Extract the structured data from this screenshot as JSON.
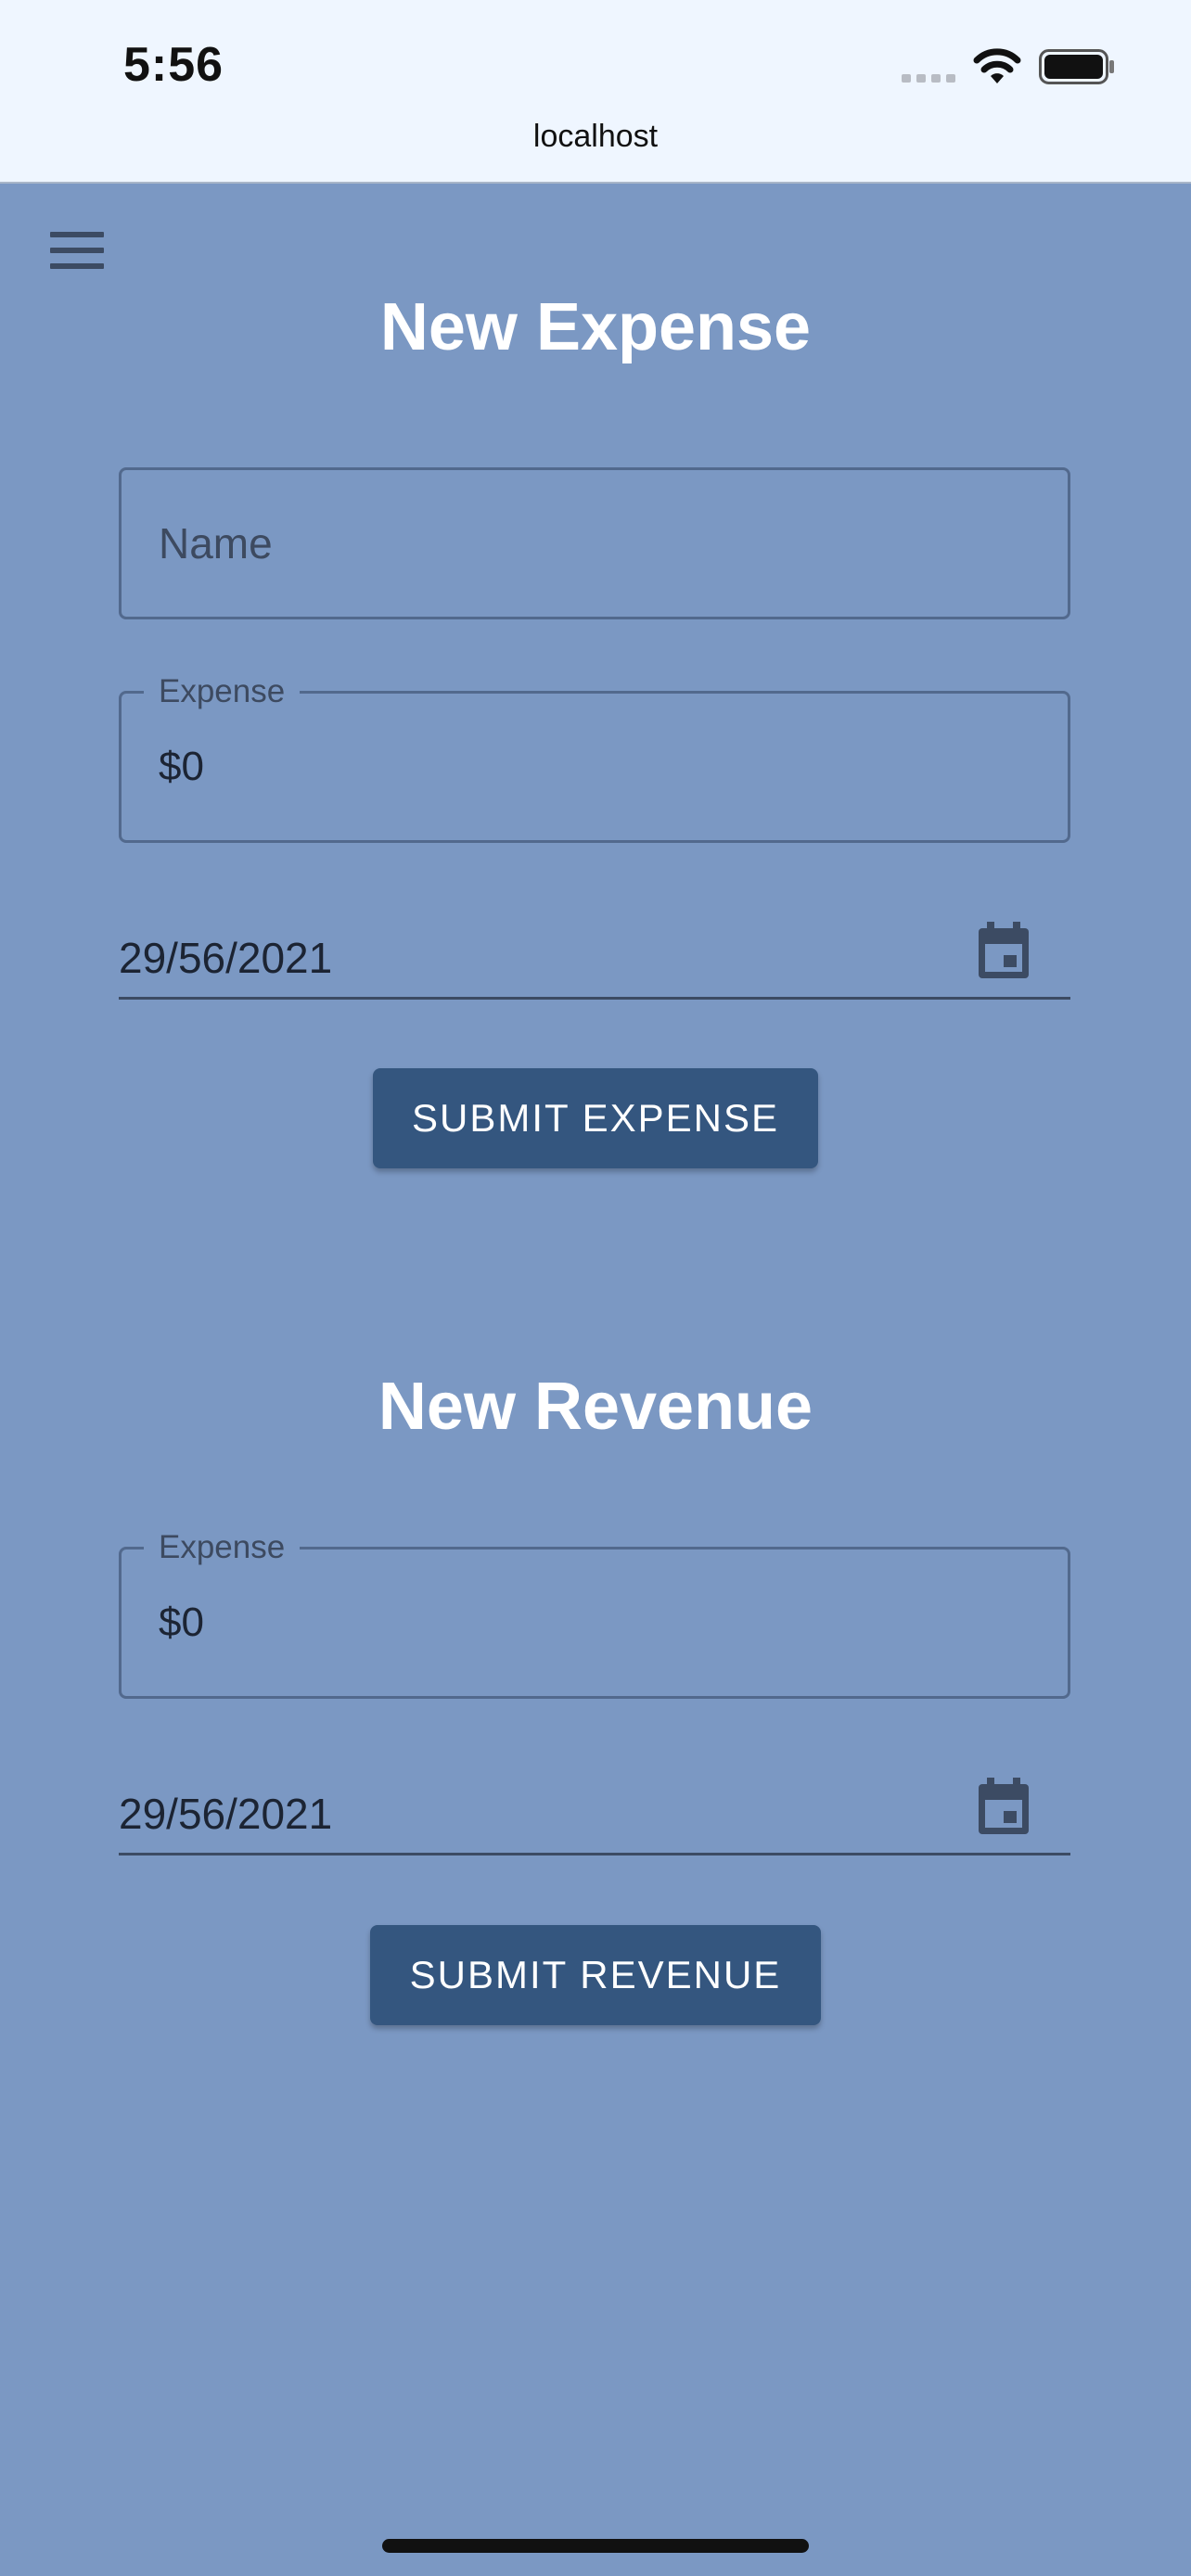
{
  "status_bar": {
    "time": "5:56",
    "icons": [
      "cellular-signal-icon",
      "wifi-icon",
      "battery-icon"
    ]
  },
  "address_bar": {
    "url": "localhost"
  },
  "menu": {
    "icon": "hamburger-menu-icon"
  },
  "expense_form": {
    "title": "New Expense",
    "name_field": {
      "placeholder": "Name",
      "value": ""
    },
    "amount_field": {
      "label": "Expense",
      "value": "$0"
    },
    "date_field": {
      "value": "29/56/2021",
      "icon": "calendar-icon"
    },
    "submit_label": "SUBMIT EXPENSE"
  },
  "revenue_form": {
    "title": "New Revenue",
    "amount_field": {
      "label": "Expense",
      "value": "$0"
    },
    "date_field": {
      "value": "29/56/2021",
      "icon": "calendar-icon"
    },
    "submit_label": "SUBMIT REVENUE"
  },
  "colors": {
    "background": "#7b98c3",
    "status_bar_bg": "#eff6ff",
    "button_bg": "#34567f",
    "title_text": "#ffffff"
  }
}
